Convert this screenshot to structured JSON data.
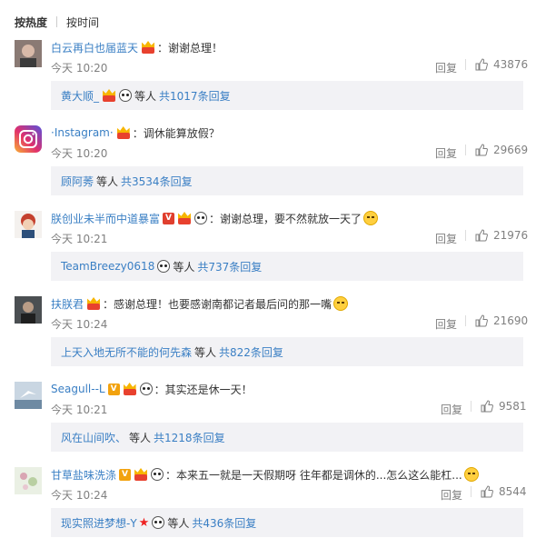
{
  "sort": {
    "hot": "按热度",
    "time": "按时间"
  },
  "comments": [
    {
      "user": "白云再白也届蓝天",
      "text": "谢谢总理！",
      "time": "今天 10:20",
      "reply": "回复",
      "likes": "43876",
      "sub_user": "黄大顺_",
      "sub_etc": "等人",
      "sub_link": "共1017条回复"
    },
    {
      "user": "·Instagram·",
      "text": "调休能算放假？",
      "time": "今天 10:20",
      "reply": "回复",
      "likes": "29669",
      "sub_user": "顾阿莠",
      "sub_etc": "等人",
      "sub_link": "共3534条回复"
    },
    {
      "user": "朕创业未半而中道暴富",
      "text": "谢谢总理，要不然就放一天了",
      "time": "今天 10:21",
      "reply": "回复",
      "likes": "21976",
      "sub_user": "TeamBreezy0618",
      "sub_etc": "等人",
      "sub_link": "共737条回复"
    },
    {
      "user": "扶朕君",
      "text": "感谢总理！也要感谢南都记者最后问的那一嘴",
      "time": "今天 10:24",
      "reply": "回复",
      "likes": "21690",
      "sub_user": "上天入地无所不能的何先森",
      "sub_etc": "等人",
      "sub_link": "共822条回复"
    },
    {
      "user": "Seagull--L",
      "text": "其实还是休一天！",
      "time": "今天 10:21",
      "reply": "回复",
      "likes": "9581",
      "sub_user": "风在山间吹、",
      "sub_etc": "等人",
      "sub_link": "共1218条回复"
    },
    {
      "user": "甘草盐味洗涤",
      "text": "本来五一就是一天假期呀 往年都是调休的...怎么这么能杠...",
      "time": "今天 10:24",
      "reply": "回复",
      "likes": "8544",
      "sub_user": "现实照进梦想-Y",
      "sub_etc": "等人",
      "sub_link": "共436条回复"
    }
  ]
}
